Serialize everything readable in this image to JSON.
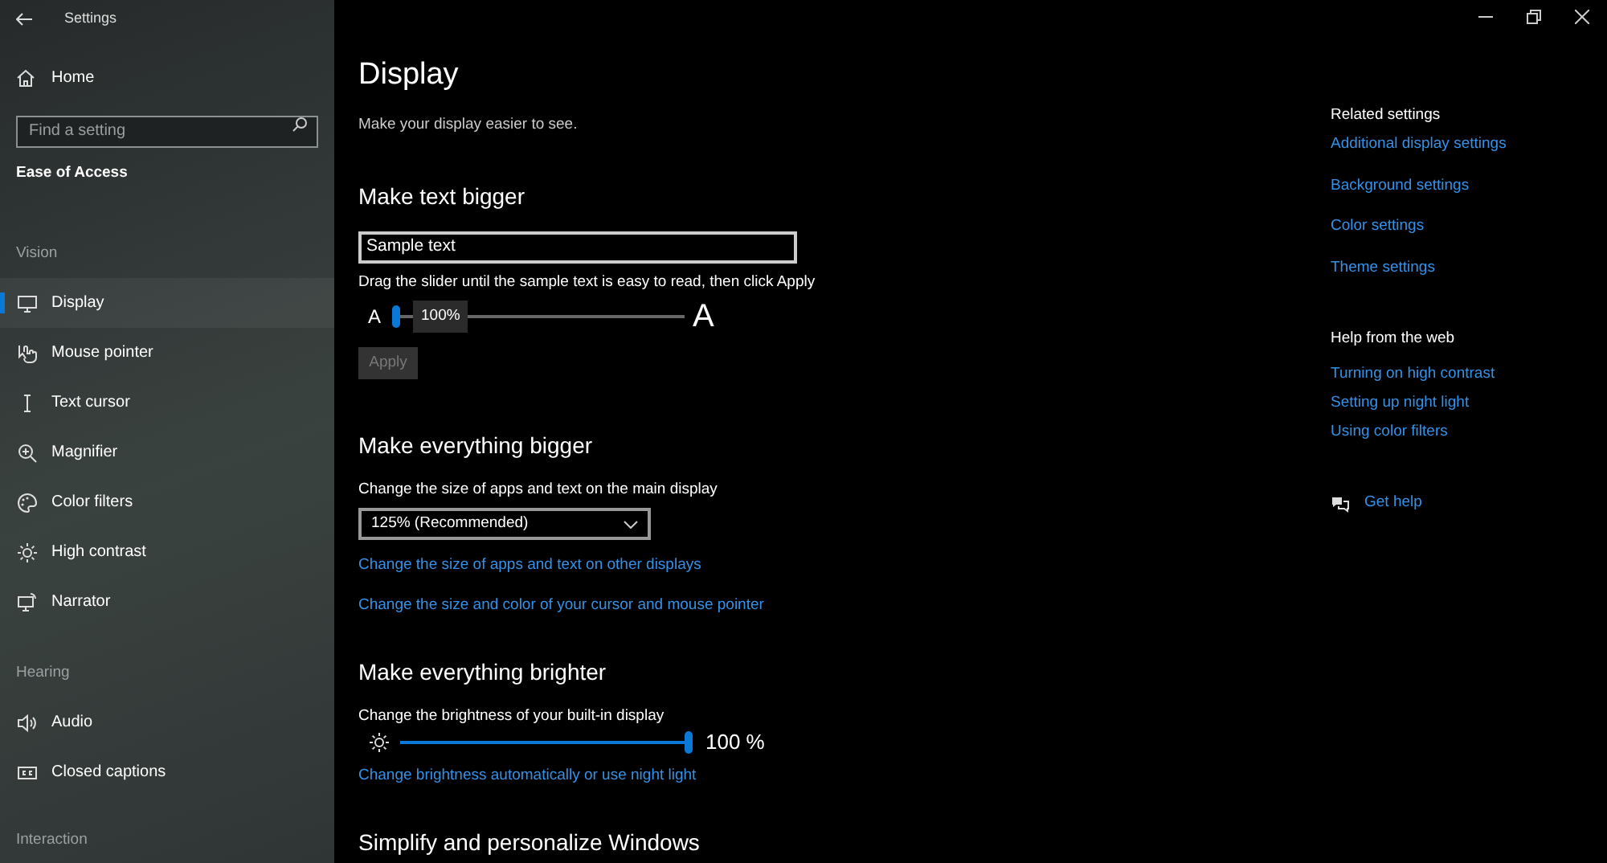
{
  "window": {
    "title": "Settings"
  },
  "sidebar": {
    "home": "Home",
    "search": {
      "placeholder": "Find a setting"
    },
    "category": "Ease of Access",
    "sections": [
      {
        "heading": "Vision",
        "items": [
          {
            "label": "Display",
            "selected": true
          },
          {
            "label": "Mouse pointer",
            "selected": false
          },
          {
            "label": "Text cursor",
            "selected": false
          },
          {
            "label": "Magnifier",
            "selected": false
          },
          {
            "label": "Color filters",
            "selected": false
          },
          {
            "label": "High contrast",
            "selected": false
          },
          {
            "label": "Narrator",
            "selected": false
          }
        ]
      },
      {
        "heading": "Hearing",
        "items": [
          {
            "label": "Audio",
            "selected": false
          },
          {
            "label": "Closed captions",
            "selected": false
          }
        ]
      },
      {
        "heading": "Interaction"
      }
    ]
  },
  "page": {
    "title": "Display",
    "subtitle": "Make your display easier to see.",
    "text_size": {
      "heading": "Make text bigger",
      "sample": "Sample text",
      "hint": "Drag the slider until the sample text is easy to read, then click Apply",
      "small_label": "A",
      "large_label": "A",
      "level": 0,
      "tooltip": "100%",
      "apply": {
        "label": "Apply",
        "disabled": true
      }
    },
    "scale": {
      "heading": "Make everything bigger",
      "label": "Change the size of apps and text on the main display",
      "value": "125% (Recommended)",
      "links": [
        "Change the size of apps and text on other displays",
        "Change the size and color of your cursor and mouse pointer"
      ]
    },
    "brightness": {
      "heading": "Make everything brighter",
      "label": "Change the brightness of your built-in display",
      "level": 1,
      "reading": "100 %",
      "link": "Change brightness automatically or use night light"
    },
    "next_heading": "Simplify and personalize Windows"
  },
  "related": {
    "heading": "Related settings",
    "links": [
      "Additional display settings",
      "Background settings",
      "Color settings",
      "Theme settings"
    ]
  },
  "help": {
    "heading": "Help from the web",
    "links": [
      "Turning on high contrast",
      "Setting up night light",
      "Using color filters"
    ],
    "get_help": "Get help"
  }
}
